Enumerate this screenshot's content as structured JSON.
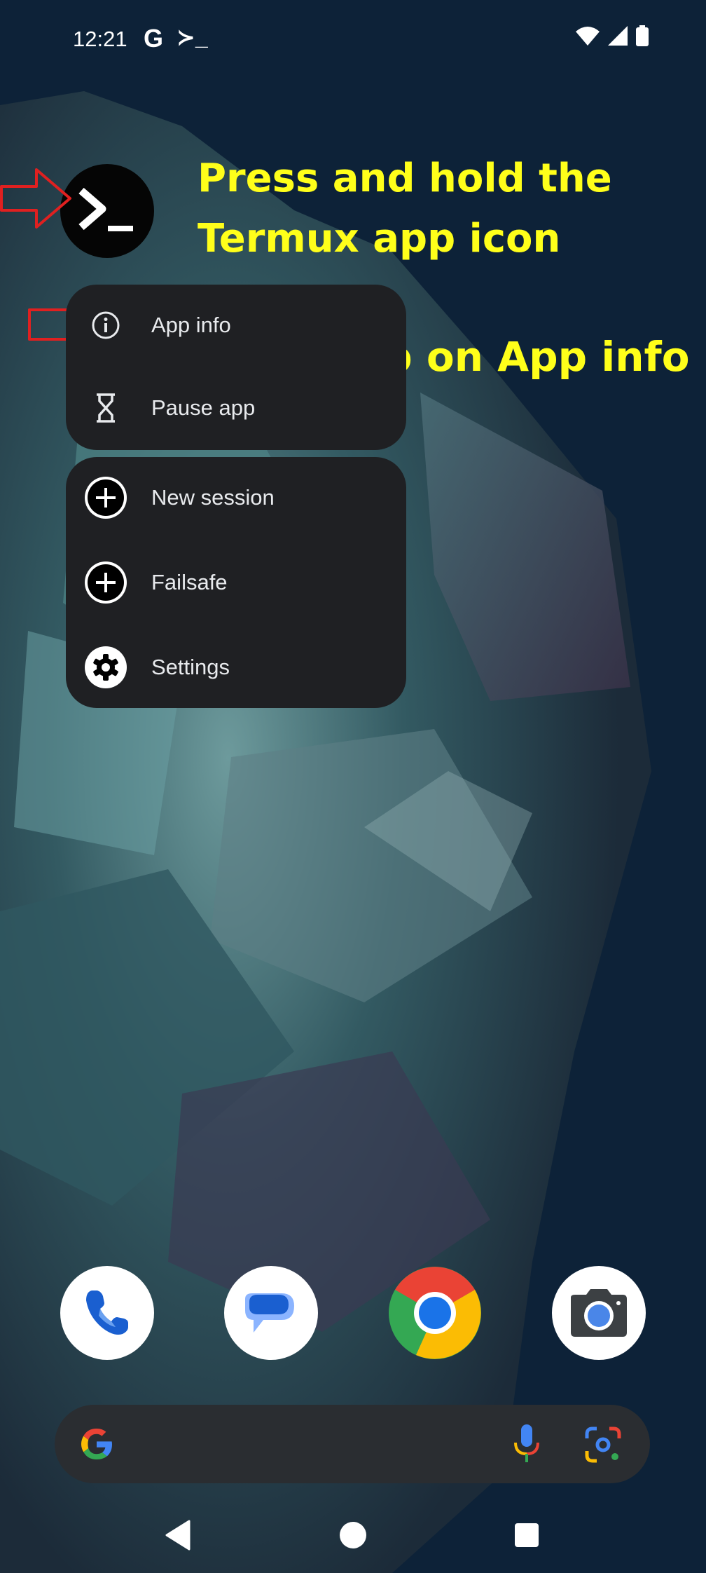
{
  "status_bar": {
    "time": "12:21",
    "notif_google": "G",
    "notif_termux": "≻_"
  },
  "annotations": {
    "press_hold_line1": "Press and hold the",
    "press_hold_line2": "Termux app icon",
    "tap_app_info": "Tap on App info"
  },
  "shortcut_menu": {
    "system_items": [
      {
        "label": "App info",
        "icon": "info-icon"
      },
      {
        "label": "Pause app",
        "icon": "hourglass-icon"
      }
    ],
    "app_items": [
      {
        "label": "New session",
        "icon": "plus-circle-icon"
      },
      {
        "label": "Failsafe",
        "icon": "plus-circle-icon"
      },
      {
        "label": "Settings",
        "icon": "gear-icon"
      }
    ]
  },
  "dock": {
    "apps": [
      "phone-icon",
      "messages-icon",
      "chrome-icon",
      "camera-icon"
    ]
  },
  "colors": {
    "annotation": "#ffff1a",
    "menu_bg": "#1f2023",
    "arrow": "#e02020",
    "wallpaper_bg": "#0d2238"
  }
}
